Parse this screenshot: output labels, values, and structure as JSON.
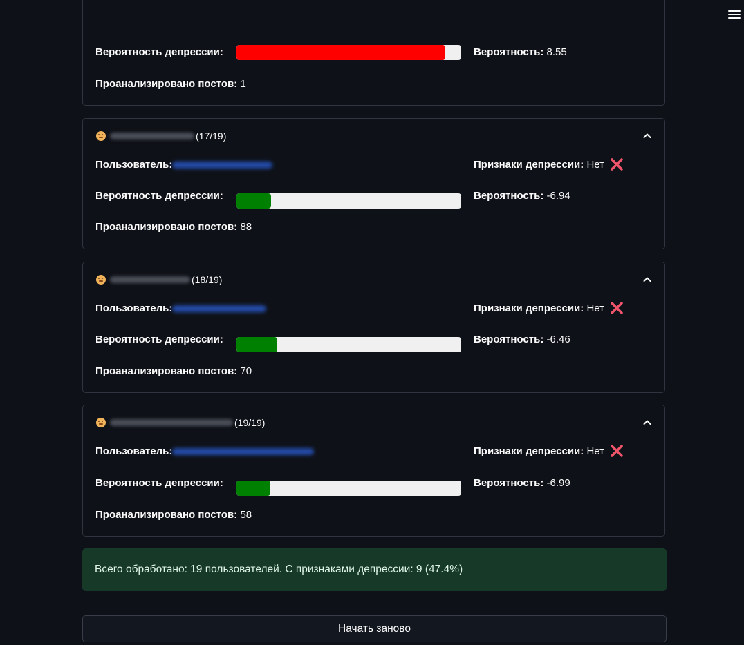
{
  "colors": {
    "background": "#0e1117",
    "bar_high": "#ff0000",
    "bar_low": "#008000",
    "bar_track": "#f0f0f0",
    "summary_bg": "#173928",
    "x_mark": "#f0556b"
  },
  "labels": {
    "user": "Пользователь:",
    "signs": "Признаки депрессии:",
    "prob_bar": "Вероятность депрессии:",
    "prob": "Вероятность:",
    "posts": "Проанализировано постов:"
  },
  "partial_card": {
    "probability": "8.55",
    "bar_fraction": 0.93,
    "bar_color": "#ff0000",
    "posts": "1"
  },
  "users": [
    {
      "counter": "(17/19)",
      "signs_value": "Нет",
      "signs_icon": "cross-mark-icon",
      "probability": "-6.94",
      "bar_fraction": 0.155,
      "bar_color": "#008000",
      "posts": "88"
    },
    {
      "counter": "(18/19)",
      "signs_value": "Нет",
      "signs_icon": "cross-mark-icon",
      "probability": "-6.46",
      "bar_fraction": 0.18,
      "bar_color": "#008000",
      "posts": "70"
    },
    {
      "counter": "(19/19)",
      "signs_value": "Нет",
      "signs_icon": "cross-mark-icon",
      "probability": "-6.99",
      "bar_fraction": 0.152,
      "bar_color": "#008000",
      "posts": "58"
    }
  ],
  "summary": "Всего обработано: 19 пользователей. С признаками депрессии: 9 (47.4%)",
  "restart_label": "Начать заново"
}
